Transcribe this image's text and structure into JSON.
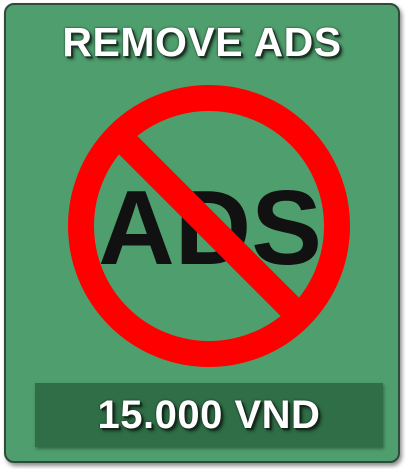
{
  "offer": {
    "title": "REMOVE ADS",
    "icon_text": "ADS",
    "icon_name": "no-ads-icon",
    "price": "15.000 VND"
  },
  "colors": {
    "card_background": "#4f9e6d",
    "price_background": "#2f6e46",
    "prohibition_red": "#ff0000",
    "text_white": "#ffffff",
    "icon_text": "#111111"
  }
}
